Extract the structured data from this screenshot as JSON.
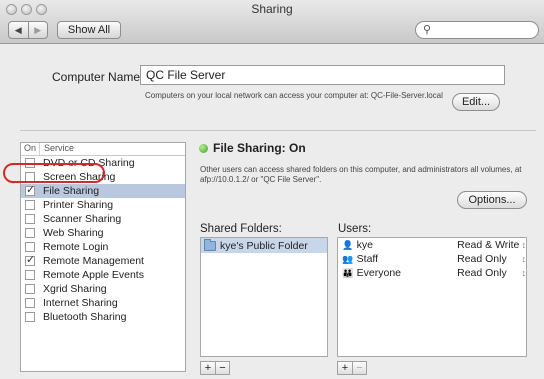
{
  "window": {
    "title": "Sharing"
  },
  "toolbar": {
    "back_glyph": "◀",
    "forward_glyph": "▶",
    "show_all_label": "Show All",
    "search_placeholder": ""
  },
  "computer_name": {
    "label": "Computer Name:",
    "value": "QC File Server",
    "description": "Computers on your local network can access your computer at: QC-File-Server.local",
    "edit_label": "Edit..."
  },
  "service_list": {
    "header_on": "On",
    "header_service": "Service",
    "items": [
      {
        "label": "DVD or CD Sharing",
        "checked": false,
        "selected": false
      },
      {
        "label": "Screen Sharing",
        "checked": false,
        "selected": false
      },
      {
        "label": "File Sharing",
        "checked": true,
        "selected": true
      },
      {
        "label": "Printer Sharing",
        "checked": false,
        "selected": false
      },
      {
        "label": "Scanner Sharing",
        "checked": false,
        "selected": false
      },
      {
        "label": "Web Sharing",
        "checked": false,
        "selected": false
      },
      {
        "label": "Remote Login",
        "checked": false,
        "selected": false
      },
      {
        "label": "Remote Management",
        "checked": true,
        "selected": false
      },
      {
        "label": "Remote Apple Events",
        "checked": false,
        "selected": false
      },
      {
        "label": "Xgrid Sharing",
        "checked": false,
        "selected": false
      },
      {
        "label": "Internet Sharing",
        "checked": false,
        "selected": false
      },
      {
        "label": "Bluetooth Sharing",
        "checked": false,
        "selected": false
      }
    ]
  },
  "file_sharing": {
    "status": "File Sharing: On",
    "status_color": "#3e9d2d",
    "description": "Other users can access shared folders on this computer, and administrators all volumes, at afp://10.0.1.2/ or \"QC File Server\".",
    "options_label": "Options...",
    "shared_folders_label": "Shared Folders:",
    "shared_folders": [
      {
        "name": "kye's Public Folder"
      }
    ],
    "users_label": "Users:",
    "users": [
      {
        "name": "kye",
        "permission": "Read & Write",
        "icon": "user-icon"
      },
      {
        "name": "Staff",
        "permission": "Read Only",
        "icon": "group-icon"
      },
      {
        "name": "Everyone",
        "permission": "Read Only",
        "icon": "everyone-icon"
      }
    ]
  },
  "buttons": {
    "add_label": "+",
    "remove_label": "−"
  },
  "highlight_color": "#d62a2a"
}
